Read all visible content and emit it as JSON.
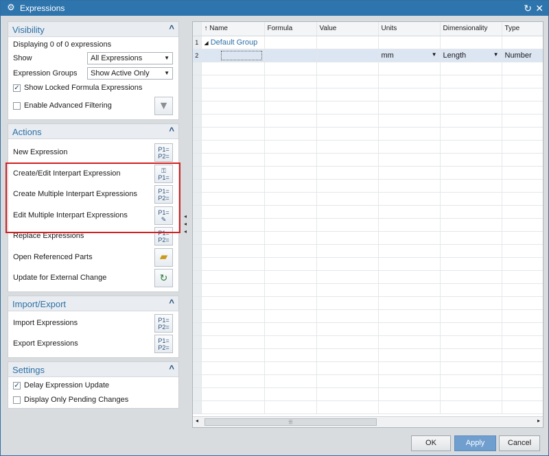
{
  "window": {
    "title": "Expressions"
  },
  "visibility": {
    "title": "Visibility",
    "displaying": "Displaying 0 of 0 expressions",
    "show_label": "Show",
    "show_value": "All Expressions",
    "groups_label": "Expression Groups",
    "groups_value": "Show Active Only",
    "show_locked": "Show Locked Formula Expressions",
    "enable_filtering": "Enable Advanced Filtering"
  },
  "actions": {
    "title": "Actions",
    "items": [
      {
        "label": "New Expression",
        "icon": "new-expression-icon"
      },
      {
        "label": "Create/Edit Interpart Expression",
        "icon": "interpart-expression-icon"
      },
      {
        "label": "Create Multiple Interpart Expressions",
        "icon": "multiple-interpart-icon"
      },
      {
        "label": "Edit Multiple Interpart Expressions",
        "icon": "edit-multiple-interpart-icon"
      },
      {
        "label": "Replace Expressions",
        "icon": "replace-expressions-icon"
      },
      {
        "label": "Open Referenced Parts",
        "icon": "open-folder-icon"
      },
      {
        "label": "Update for External Change",
        "icon": "update-external-icon"
      }
    ]
  },
  "import_export": {
    "title": "Import/Export",
    "import_label": "Import Expressions",
    "export_label": "Export Expressions"
  },
  "settings": {
    "title": "Settings",
    "delay_update": "Delay Expression Update",
    "pending_only": "Display Only Pending Changes"
  },
  "grid": {
    "columns": [
      "Name",
      "Formula",
      "Value",
      "Units",
      "Dimensionality",
      "Type"
    ],
    "row1_num": "1",
    "group_name": "Default Group",
    "row2_num": "2",
    "row2_units": "mm",
    "row2_dimensionality": "Length",
    "row2_type": "Number"
  },
  "buttons": {
    "ok": "OK",
    "apply": "Apply",
    "cancel": "Cancel"
  },
  "colors": {
    "accent": "#2e74ad",
    "highlight": "#d21f1f"
  }
}
